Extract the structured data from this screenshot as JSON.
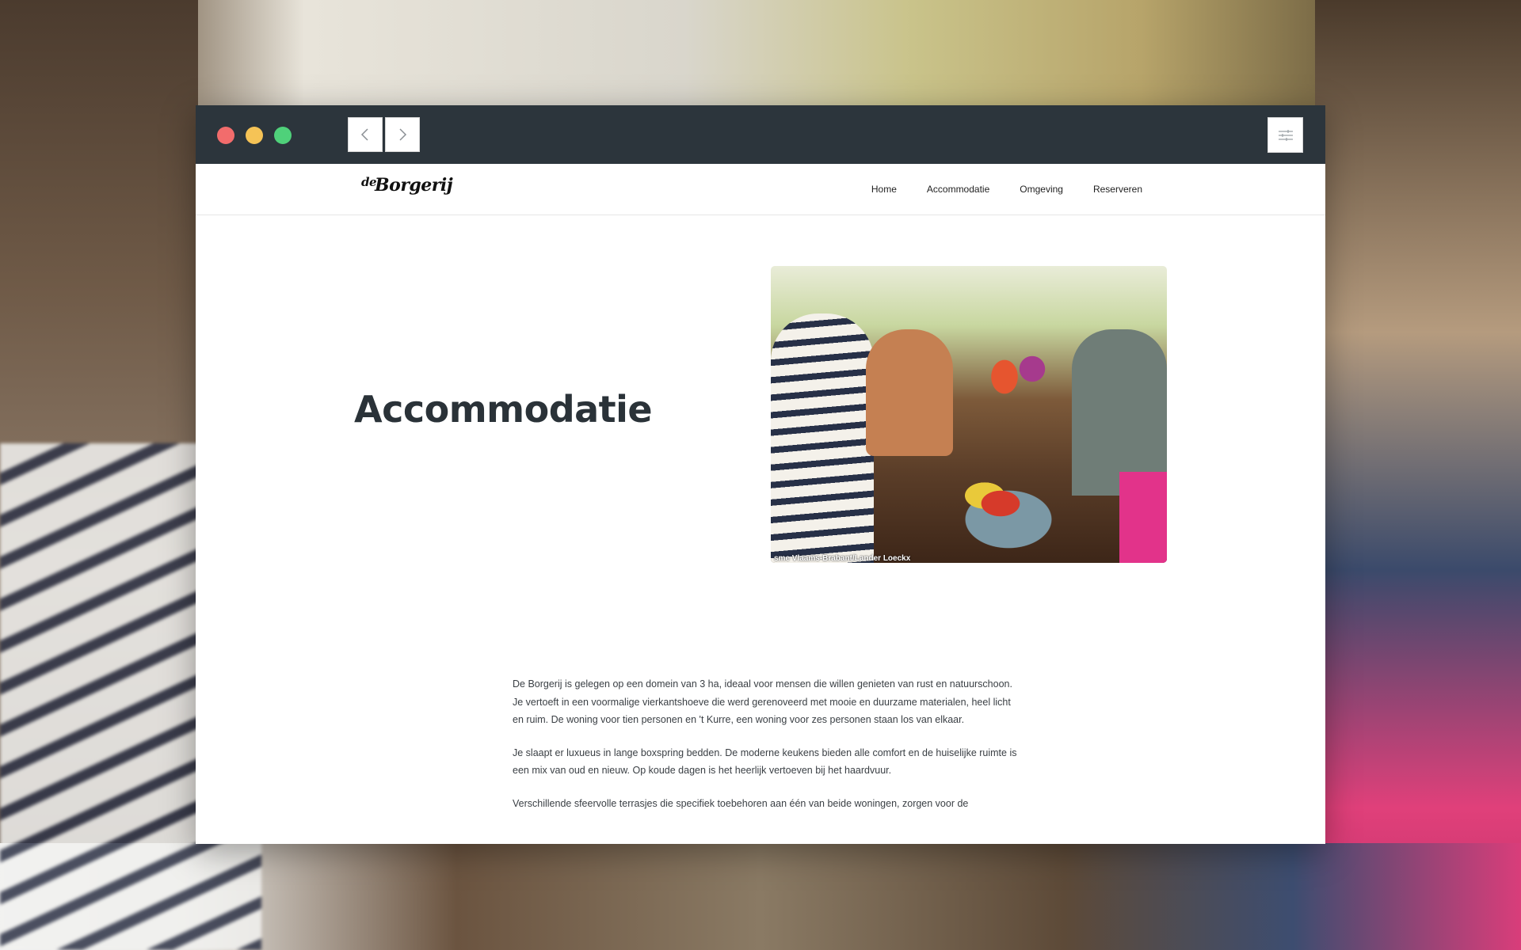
{
  "window": {
    "back_icon": "chevron-left-icon",
    "forward_icon": "chevron-right-icon",
    "menu_icon": "sliders-icon",
    "colors": {
      "titlebar": "#2c353c",
      "close": "#f26c6c",
      "minimize": "#f5c356",
      "maximize": "#4fd17a"
    }
  },
  "site": {
    "logo": {
      "prefix": "de",
      "name": "Borgerij"
    },
    "nav": [
      {
        "label": "Home"
      },
      {
        "label": "Accommodatie"
      },
      {
        "label": "Omgeving"
      },
      {
        "label": "Reserveren"
      }
    ]
  },
  "hero": {
    "title": "Accommodatie",
    "photo_credit": "sme Vlaams-Brabant/Lander Loeckx"
  },
  "content": {
    "paragraphs": [
      "De Borgerij is gelegen op een domein van 3 ha, ideaal voor mensen die willen genieten van rust en natuurschoon. Je vertoeft in een voormalige vierkantshoeve die werd gerenoveerd met mooie en duurzame materialen, heel licht en ruim. De woning voor tien personen en 't Kurre, een woning voor zes personen staan los van elkaar.",
      "Je slaapt er luxueus in lange boxspring bedden. De moderne keukens bieden alle comfort en de huiselijke ruimte is een mix van oud en nieuw. Op koude dagen is het heerlijk vertoeven bij het haardvuur.",
      "Verschillende sfeervolle terrasjes die specifiek toebehoren aan één van beide woningen, zorgen voor de"
    ]
  }
}
